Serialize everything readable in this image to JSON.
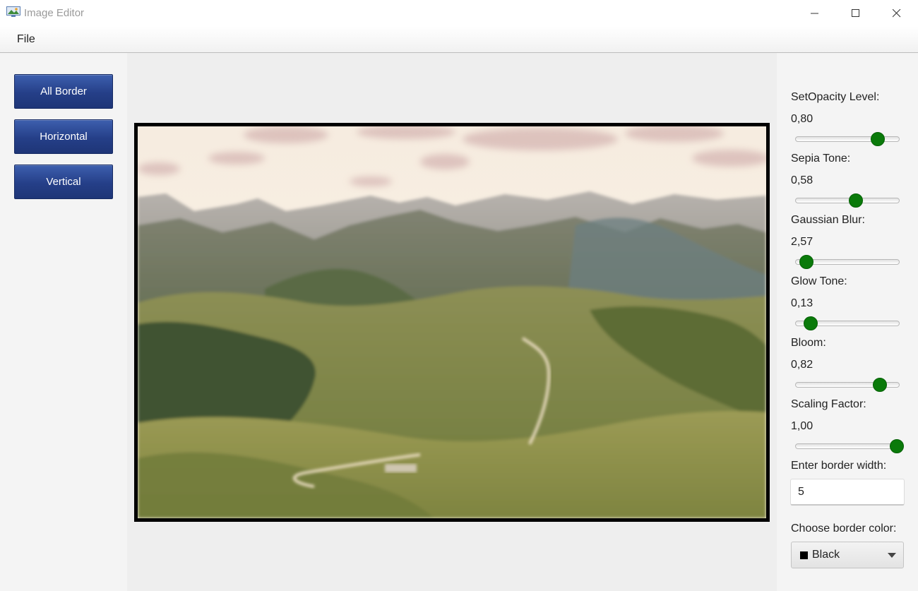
{
  "window": {
    "title": "Image Editor",
    "controls": [
      "minimize-icon",
      "maximize-icon",
      "close-icon"
    ]
  },
  "menu": {
    "items": [
      {
        "label": "File"
      }
    ]
  },
  "sidebar": {
    "buttons": [
      {
        "label": "All Border"
      },
      {
        "label": "Horizontal"
      },
      {
        "label": "Vertical"
      }
    ],
    "button_color": "#253f88"
  },
  "canvas": {
    "image_description_icon": "mountain-landscape-image",
    "border_color": "#000000"
  },
  "controls": {
    "accent_color": "#0a7a0a",
    "sliders": [
      {
        "label": "SetOpacity Level:",
        "value": "0,80",
        "position": 0.79
      },
      {
        "label": "Sepia Tone:",
        "value": "0,58",
        "position": 0.58
      },
      {
        "label": "Gaussian Blur:",
        "value": "2,57",
        "position": 0.11
      },
      {
        "label": "Glow Tone:",
        "value": "0,13",
        "position": 0.15
      },
      {
        "label": "Bloom:",
        "value": "0,82",
        "position": 0.81
      },
      {
        "label": "Scaling Factor:",
        "value": "1,00",
        "position": 0.97
      }
    ],
    "border_width": {
      "label": "Enter border width:",
      "value": "5"
    },
    "border_color": {
      "label": "Choose border color:",
      "selected": "Black",
      "swatch": "#000000"
    }
  }
}
